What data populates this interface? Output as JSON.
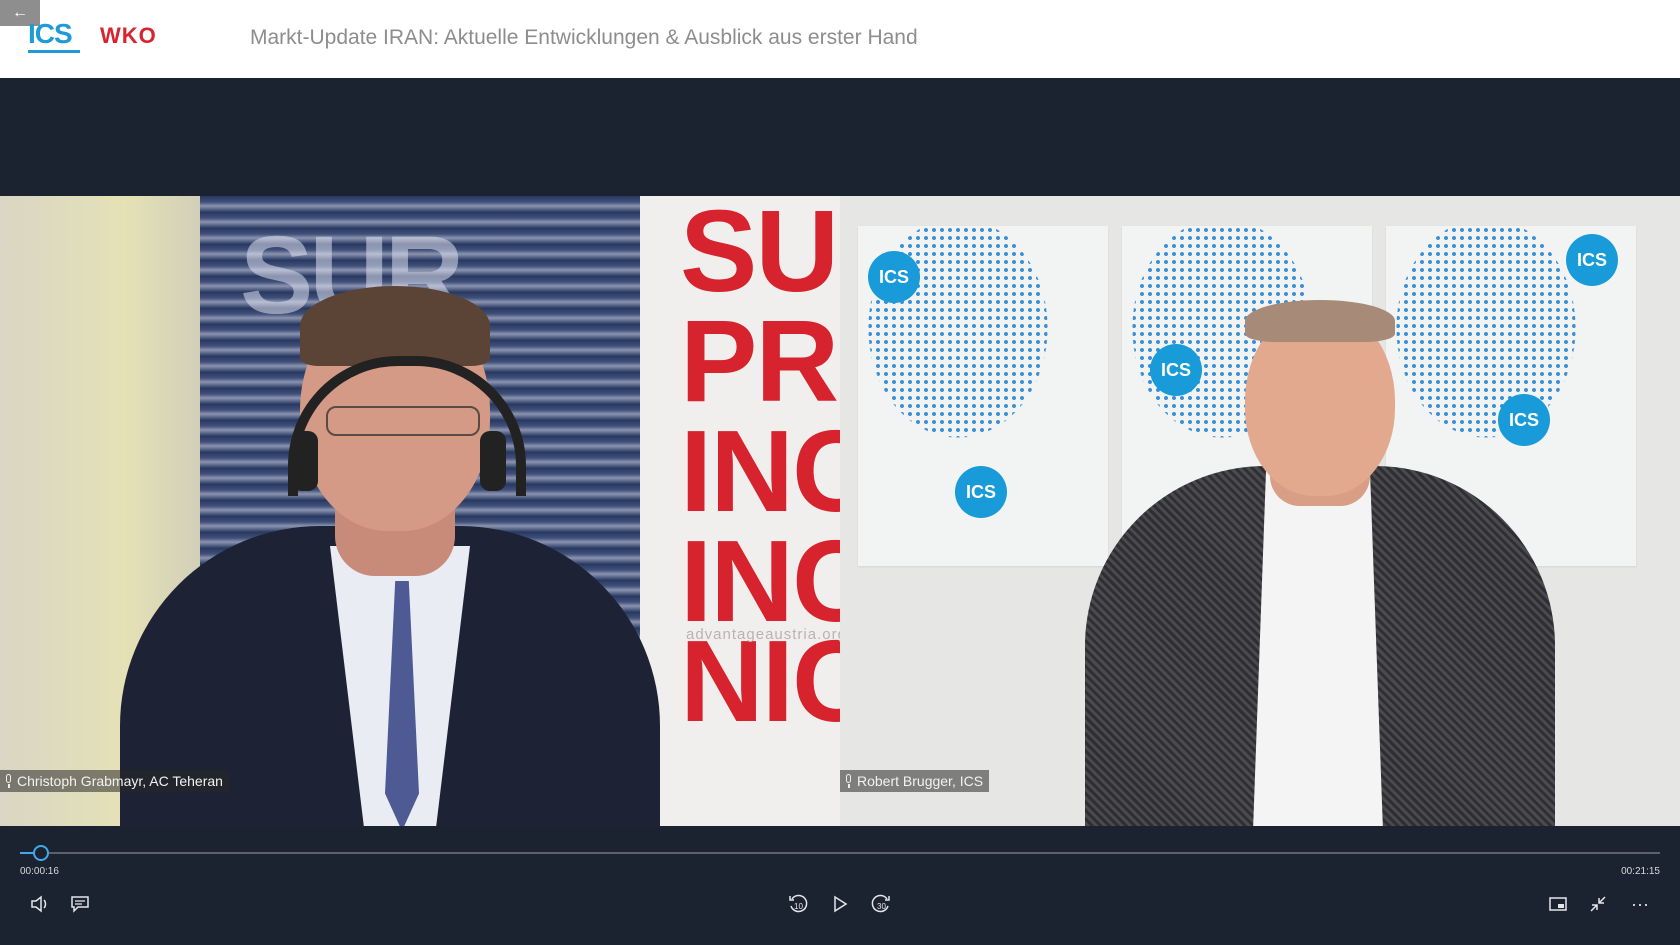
{
  "header": {
    "back_glyph": "←",
    "logo_ics": "ICS",
    "logo_wko": "WKO",
    "title": "Markt-Update IRAN: Aktuelle Entwicklungen & Ausblick aus erster Hand"
  },
  "video": {
    "left": {
      "banner_lines": [
        "SU",
        "PR",
        "INC",
        "INC",
        "NIC"
      ],
      "backdrop_text": "SUR",
      "banner_url": "advantageaustria.org",
      "speaker_name": "Christoph Grabmayr, AC Teheran"
    },
    "right": {
      "badge_text": "ICS",
      "speaker_name": "Robert Brugger, ICS"
    }
  },
  "player": {
    "current_time": "00:00:16",
    "total_time": "00:21:15",
    "progress_fraction": 0.0125,
    "accent_color": "#41a9ea",
    "icons": [
      "volume-icon",
      "captions-icon",
      "rewind-10-icon",
      "play-icon",
      "forward-30-icon",
      "miniplayer-icon",
      "exit-fullscreen-icon",
      "more-options-icon"
    ],
    "rewind_label": "10",
    "forward_label": "30",
    "more_glyph": "···"
  }
}
